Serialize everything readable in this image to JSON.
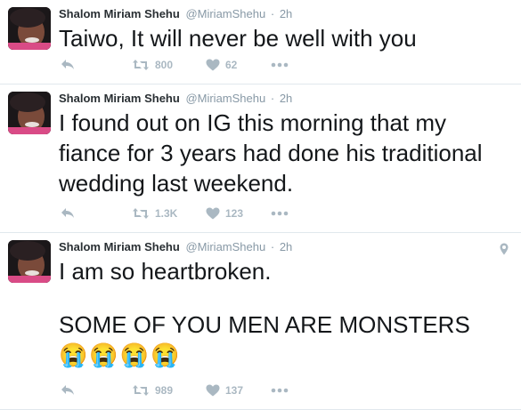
{
  "tweets": [
    {
      "author": "Shalom Miriam Shehu",
      "handle": "@MiriamShehu",
      "separator": "·",
      "time": "2h",
      "lines": [
        "Taiwo, It will never be well with you"
      ],
      "retweets": "800",
      "likes": "62"
    },
    {
      "author": "Shalom Miriam Shehu",
      "handle": "@MiriamShehu",
      "separator": "·",
      "time": "2h",
      "lines": [
        "I found out on IG this morning that my",
        "fiance for 3 years had done his traditional",
        "wedding last weekend."
      ],
      "retweets": "1.3K",
      "likes": "123"
    },
    {
      "author": "Shalom Miriam Shehu",
      "handle": "@MiriamShehu",
      "separator": "·",
      "time": "2h",
      "lines": [
        "I am so heartbroken.",
        "",
        "SOME OF YOU MEN ARE MONSTERS"
      ],
      "emoji": "😭😭😭😭",
      "retweets": "989",
      "likes": "137"
    }
  ],
  "icons": {
    "reply": "reply-icon",
    "retweet": "retweet-icon",
    "like": "heart-icon",
    "more": "more-icon",
    "location": "location-pin-icon"
  },
  "colors": {
    "action_gray": "#aab8c2",
    "meta_gray": "#8899a6",
    "divider": "#e1e8ed"
  }
}
